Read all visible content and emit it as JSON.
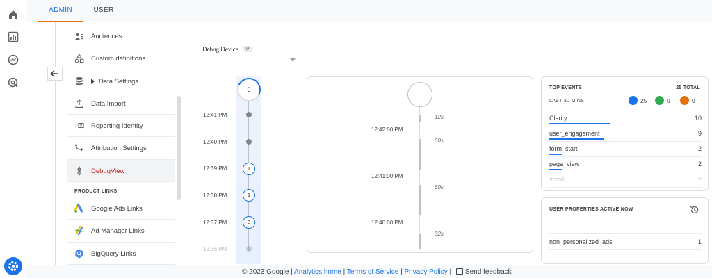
{
  "tabs": [
    {
      "label": "ADMIN"
    },
    {
      "label": "USER"
    }
  ],
  "menu": {
    "items": [
      {
        "label": "Audiences",
        "icon": "audiences-icon"
      },
      {
        "label": "Custom definitions",
        "icon": "shapes-icon"
      },
      {
        "label": "Data Settings",
        "icon": "database-icon"
      },
      {
        "label": "Data Import",
        "icon": "upload-icon"
      },
      {
        "label": "Reporting Identity",
        "icon": "identity-icon"
      },
      {
        "label": "Attribution Settings",
        "icon": "attribution-icon"
      },
      {
        "label": "DebugView",
        "icon": "debug-icon"
      }
    ],
    "section_product_links": "PRODUCT LINKS",
    "links": [
      {
        "label": "Google Ads Links",
        "icon": "google-ads-icon"
      },
      {
        "label": "Ad Manager Links",
        "icon": "ad-manager-icon"
      },
      {
        "label": "BigQuery Links",
        "icon": "bigquery-icon"
      }
    ]
  },
  "debug_device": {
    "label": "Debug Device",
    "count": "0"
  },
  "minutes_stream": {
    "top_count": "0",
    "rows": [
      {
        "time": "12:41 PM",
        "marker": "dot"
      },
      {
        "time": "12:40 PM",
        "marker": "dot"
      },
      {
        "time": "12:39 PM",
        "marker": "1"
      },
      {
        "time": "12:38 PM",
        "marker": "1"
      },
      {
        "time": "12:37 PM",
        "marker": "3"
      },
      {
        "time": "12:36 PM",
        "marker": "dot"
      }
    ]
  },
  "seconds_stream": {
    "durations": [
      "12s",
      "60s",
      "60s",
      "32s"
    ],
    "times": [
      "12:42:00 PM",
      "12:41:00 PM",
      "12:40:00 PM"
    ]
  },
  "top_events": {
    "title": "TOP EVENTS",
    "total": "25 TOTAL",
    "subtitle": "LAST 30 MINS",
    "counts": [
      {
        "value": "25",
        "color": "#1a73e8",
        "icon": "event-icon"
      },
      {
        "value": "0",
        "color": "#34a853",
        "icon": "flag-icon"
      },
      {
        "value": "0",
        "color": "#e8710a",
        "icon": "error-icon"
      }
    ],
    "rows": [
      {
        "name": "Clarity",
        "value": "10",
        "share": 0.4
      },
      {
        "name": "user_engagement",
        "value": "9",
        "share": 0.36
      },
      {
        "name": "form_start",
        "value": "2",
        "share": 0.08
      },
      {
        "name": "page_view",
        "value": "2",
        "share": 0.08
      },
      {
        "name": "scroll",
        "value": "2",
        "share": 0.08
      }
    ]
  },
  "user_properties": {
    "title": "USER PROPERTIES ACTIVE NOW",
    "rows": [
      {
        "name": "non_personalized_ads",
        "value": "1"
      }
    ]
  },
  "footer": {
    "copyright": "© 2023 Google",
    "sep": "|",
    "analytics_home": "Analytics home",
    "terms": "Terms of Service",
    "privacy": "Privacy Policy",
    "feedback": "Send feedback"
  },
  "colors": {
    "accent": "#1a73e8",
    "tab_underline": "#e8710a",
    "active_item": "#c5221f"
  }
}
